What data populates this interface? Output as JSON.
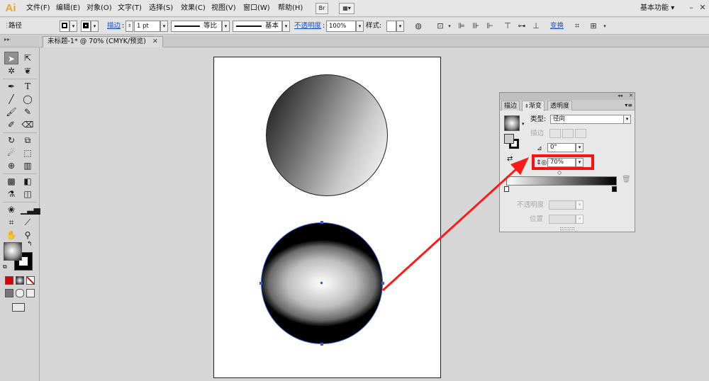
{
  "app": {
    "logo": "Ai"
  },
  "menu": {
    "items": [
      "文件(F)",
      "编辑(E)",
      "对象(O)",
      "文字(T)",
      "选择(S)",
      "效果(C)",
      "视图(V)",
      "窗口(W)",
      "帮助(H)"
    ],
    "bridge_btn": "Br",
    "workspace": "基本功能",
    "workspace_arrow": "▾",
    "win_minimize": "–",
    "win_maximize": "□",
    "win_close": "✕"
  },
  "control_bar": {
    "selection_label": "路径",
    "stroke_link": "描边",
    "stroke_weight": "1 pt",
    "profile_label": "等比",
    "brush_label": "基本",
    "opacity_link": "不透明度",
    "opacity_value": "100%",
    "style_label": "样式:",
    "transform_link": "变换"
  },
  "document": {
    "tab_title": "未标题-1* @ 70% (CMYK/预览)",
    "close_glyph": "✕"
  },
  "gradient_panel": {
    "tabs": [
      "描边",
      "渐变",
      "透明度"
    ],
    "active_tab": "渐变",
    "collapse_glyph": "◂◂",
    "close_glyph": "✕",
    "menu_glyph": "▾≡",
    "type_label": "类型:",
    "type_value": "径向",
    "stroke_label": "描边",
    "angle_value": "0°",
    "aspect_value": "70%",
    "opacity_label": "不透明度",
    "location_label": "位置",
    "colors": {
      "highlight": "#ff1010",
      "arrow": "#ff1a1a"
    }
  },
  "icons": {
    "tools": [
      "selection-arrow-icon",
      "direct-selection-icon",
      "magic-wand-icon",
      "lasso-icon",
      "pen-icon",
      "type-icon",
      "line-segment-icon",
      "ellipse-icon",
      "paintbrush-icon",
      "pencil-icon",
      "blob-brush-icon",
      "eraser-icon",
      "rotate-icon",
      "scale-icon",
      "warp-icon",
      "free-transform-icon",
      "shape-builder-icon",
      "perspective-grid-icon",
      "mesh-icon",
      "gradient-tool-icon",
      "eyedropper-icon",
      "blend-icon",
      "symbol-sprayer-icon",
      "column-graph-icon",
      "artboard-icon",
      "slice-icon",
      "hand-icon",
      "zoom-icon"
    ]
  }
}
